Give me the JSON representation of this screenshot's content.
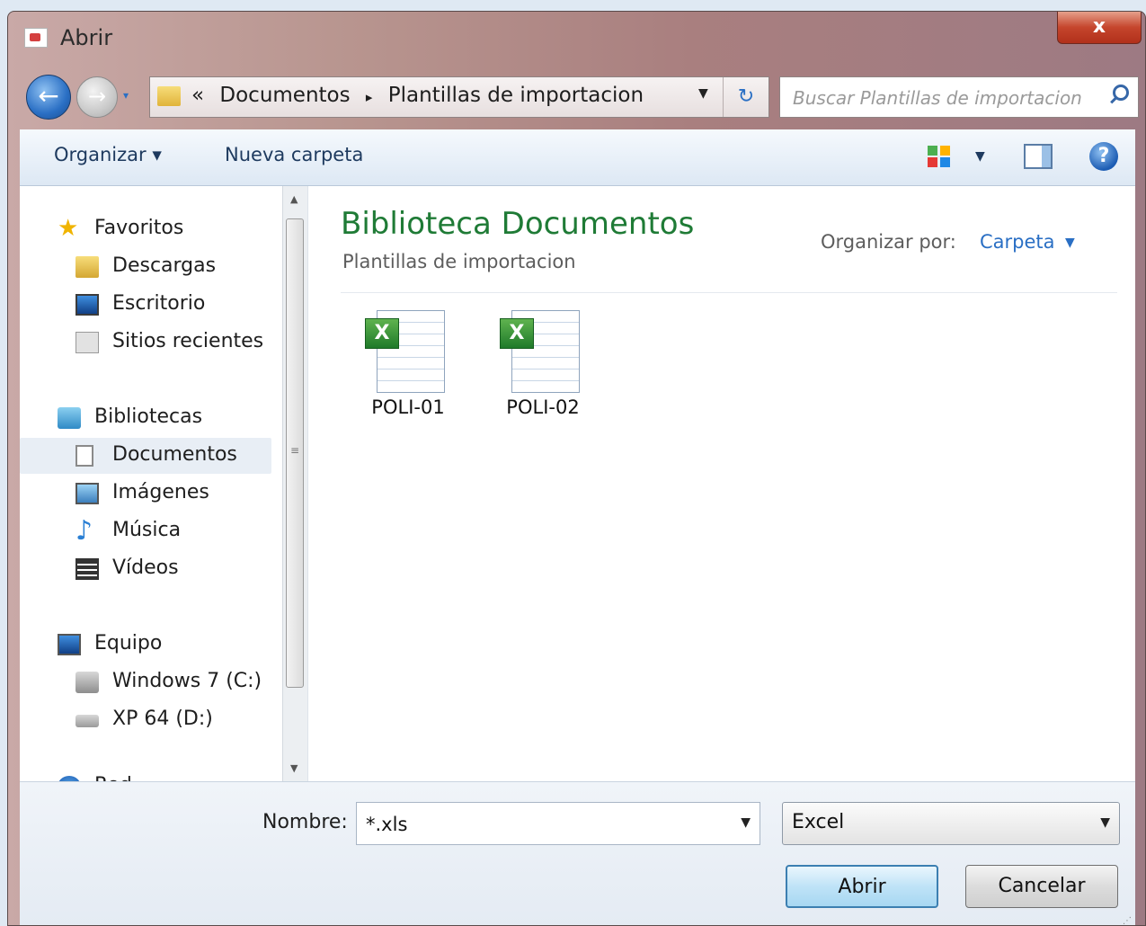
{
  "window": {
    "title": "Abrir",
    "close_label": "x"
  },
  "nav": {
    "back_label": "←",
    "forward_label": "→",
    "breadcrumb": {
      "prefix": "«",
      "items": [
        "Documentos",
        "Plantillas de importacion"
      ],
      "separator": "▸"
    },
    "search_placeholder": "Buscar Plantillas de importacion"
  },
  "toolbar": {
    "organize_label": "Organizar ▾",
    "new_folder_label": "Nueva carpeta",
    "help_label": "?"
  },
  "sidebar": {
    "items": [
      {
        "label": "Favoritos",
        "icon": "star-icon"
      },
      {
        "label": "Descargas",
        "icon": "downloads-folder-icon"
      },
      {
        "label": "Escritorio",
        "icon": "desktop-icon"
      },
      {
        "label": "Sitios recientes",
        "icon": "recent-places-icon"
      },
      {
        "label": "Bibliotecas",
        "icon": "libraries-icon"
      },
      {
        "label": "Documentos",
        "icon": "documents-icon",
        "selected": true
      },
      {
        "label": "Imágenes",
        "icon": "pictures-icon"
      },
      {
        "label": "Música",
        "icon": "music-icon"
      },
      {
        "label": "Vídeos",
        "icon": "videos-icon"
      },
      {
        "label": "Equipo",
        "icon": "computer-icon"
      },
      {
        "label": "Windows 7 (C:)",
        "icon": "windows-drive-icon"
      },
      {
        "label": "XP 64 (D:)",
        "icon": "drive-icon"
      },
      {
        "label": "Red",
        "icon": "network-icon"
      }
    ]
  },
  "content": {
    "library_title": "Biblioteca Documentos",
    "library_subtitle": "Plantillas de importacion",
    "arrange_label": "Organizar por:",
    "arrange_value": "Carpeta",
    "files": [
      {
        "name": "POLI-01",
        "icon": "excel-file-icon"
      },
      {
        "name": "POLI-02",
        "icon": "excel-file-icon"
      }
    ]
  },
  "footer": {
    "filename_label": "Nombre:",
    "filename_value": "*.xls",
    "filetype_value": "Excel",
    "open_label": "Abrir",
    "cancel_label": "Cancelar"
  },
  "colors": {
    "library_title": "#1f7b36",
    "link": "#2a6fc4",
    "open_border": "#3c7fb1"
  }
}
